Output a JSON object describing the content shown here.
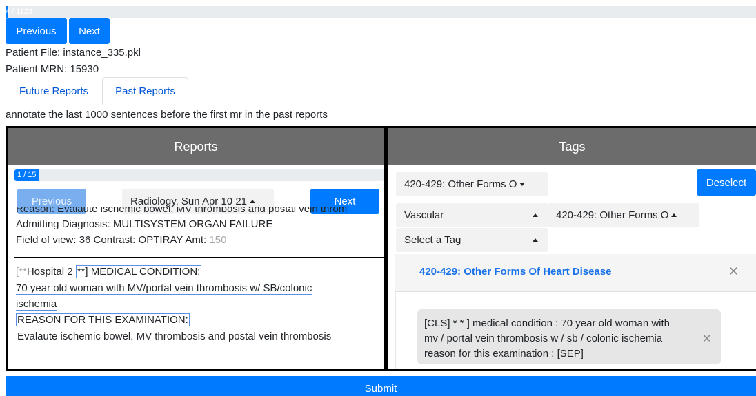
{
  "top_progress": {
    "label": "4 / 1123",
    "current": 4,
    "total": 1123
  },
  "nav": {
    "previous_label": "Previous",
    "next_label": "Next"
  },
  "patient": {
    "file_line": "Patient File: instance_335.pkl",
    "mrn_line": "Patient MRN: 15930"
  },
  "tabs": [
    {
      "label": "Future Reports",
      "active": false
    },
    {
      "label": "Past Reports",
      "active": true
    }
  ],
  "instruction": "annotate the last 1000 sentences before the first mr in the past reports",
  "reports": {
    "title": "Reports",
    "progress": {
      "label": "1 / 15",
      "current": 1,
      "total": 15
    },
    "previous_label": "Previous",
    "next_label": "Next",
    "selected_report": "Radiology, Sun Apr 10 21",
    "lines": {
      "reason_cut": "Reason:  Evalaute ischemic bowel, MV thrombosis and postal vein throm",
      "admitting": "Admitting Diagnosis:  MULTISYSTEM ORGAN FAILURE",
      "fov_prefix": "Field of view: 36 Contrast:  OPTIRAY Amt: ",
      "fov_amt": "150",
      "hospital_prefix": "[**",
      "hospital_main": "Hospital 2 ",
      "medical_condition_box": "**] MEDICAL CONDITION:",
      "woman_line": "70 year old woman with MV/portal vein thrombosis w/ SB/colonic",
      "ischemia": "ischemia",
      "reason_exam": "REASON FOR THIS EXAMINATION:",
      "evaluate": "Evalaute ischemic bowel, MV thrombosis and postal vein thrombosis"
    }
  },
  "tags": {
    "title": "Tags",
    "category_dropdown": "420-429: Other Forms O",
    "deselect_label": "Deselect",
    "group_dropdown": "Vascular",
    "subcategory_dropdown": "420-429: Other Forms O",
    "select_tag_dropdown": "Select a Tag",
    "selected_tag_title": "420-429: Other Forms Of Heart Disease",
    "chip_text": "[CLS] * * ] medical condition : 70 year old woman with mv / portal vein thrombosis w / sb / colonic ischemia reason for this examination : [SEP]",
    "accent": "#1a73e8"
  },
  "submit_label": "Submit"
}
